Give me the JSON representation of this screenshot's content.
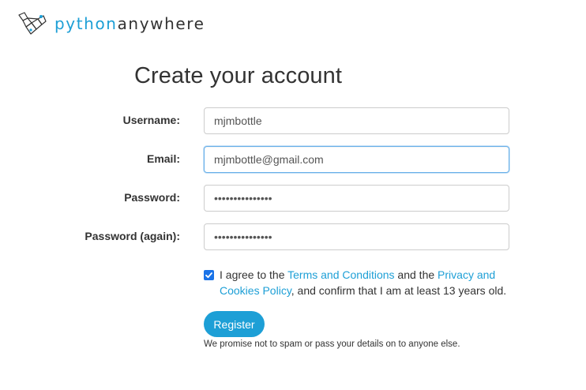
{
  "brand": {
    "logo_icon": "pythonanywhere-logo-icon",
    "name_part1": "python",
    "name_part2": "anywhere",
    "accent_color": "#1d9fd6"
  },
  "page_title": "Create your account",
  "form": {
    "username": {
      "label": "Username:",
      "value": "mjmbottle"
    },
    "email": {
      "label": "Email:",
      "value": "mjmbottle@gmail.com"
    },
    "password": {
      "label": "Password:",
      "value": "•••••••••••••••"
    },
    "password_again": {
      "label": "Password (again):",
      "value": "•••••••••••••••"
    }
  },
  "agreement": {
    "checked": true,
    "text_before": "I agree to the ",
    "terms_link": "Terms and Conditions",
    "text_middle": " and the ",
    "privacy_link": "Privacy and Cookies Policy",
    "text_after": ", and confirm that I am at least 13 years old."
  },
  "register_label": "Register",
  "promise_text": "We promise not to spam or pass your details on to anyone else."
}
